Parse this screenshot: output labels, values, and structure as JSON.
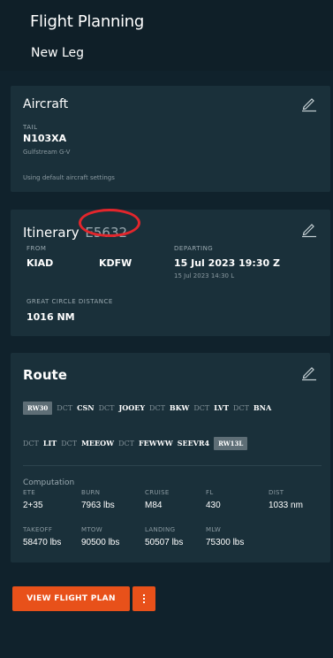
{
  "header": {
    "title": "Flight Planning",
    "subtitle": "New Leg"
  },
  "aircraft": {
    "title": "Aircraft",
    "tail_label": "TAIL",
    "tail": "N103XA",
    "model": "Gulfstream G-V",
    "settings_note": "Using default aircraft settings",
    "edit_icon": "pencil-icon"
  },
  "itinerary": {
    "title": "Itinerary",
    "annotation": "E5632",
    "from_label": "FROM",
    "from": "KIAD",
    "to": "KDFW",
    "departing_label": "DEPARTING",
    "departing": "15 Jul 2023 19:30 Z",
    "departing_local": "15 Jul 2023 14:30 L",
    "gc_label": "GREAT CIRCLE DISTANCE",
    "gc_distance": "1016 NM",
    "edit_icon": "pencil-icon"
  },
  "route": {
    "title": "Route",
    "line1": [
      {
        "t": "rw",
        "v": "RW30"
      },
      {
        "t": "kw",
        "v": "DCT"
      },
      {
        "t": "wp",
        "v": "CSN"
      },
      {
        "t": "kw",
        "v": "DCT"
      },
      {
        "t": "wp",
        "v": "JOOEY"
      },
      {
        "t": "kw",
        "v": "DCT"
      },
      {
        "t": "wp",
        "v": "BKW"
      },
      {
        "t": "kw",
        "v": "DCT"
      },
      {
        "t": "wp",
        "v": "LVT"
      },
      {
        "t": "kw",
        "v": "DCT"
      },
      {
        "t": "wp",
        "v": "BNA"
      }
    ],
    "line2": [
      {
        "t": "kw",
        "v": "DCT"
      },
      {
        "t": "wp",
        "v": "LIT"
      },
      {
        "t": "kw",
        "v": "DCT"
      },
      {
        "t": "wp",
        "v": "MEEOW"
      },
      {
        "t": "kw",
        "v": "DCT"
      },
      {
        "t": "wp",
        "v": "FEWWW"
      },
      {
        "t": "wp",
        "v": "SEEVR4"
      },
      {
        "t": "rw",
        "v": "RW13L"
      }
    ],
    "computation_title": "Computation",
    "ete_label": "ETE",
    "ete": "2+35",
    "burn_label": "BURN",
    "burn": "7963 lbs",
    "cruise_label": "CRUISE",
    "cruise": "M84",
    "fl_label": "FL",
    "fl": "430",
    "dist_label": "DIST",
    "dist": "1033 nm",
    "takeoff_label": "TAKEOFF",
    "takeoff": "58470 lbs",
    "mtow_label": "MTOW",
    "mtow": "90500 lbs",
    "landing_label": "LANDING",
    "landing": "50507 lbs",
    "mlw_label": "MLW",
    "mlw": "75300 lbs",
    "edit_icon": "pencil-icon"
  },
  "actions": {
    "view_flight_plan": "VIEW FLIGHT PLAN",
    "more_icon": "more-vertical-icon"
  },
  "colors": {
    "background": "#10222c",
    "card": "#1a303a",
    "accent": "#e8511a",
    "annotation": "#e3262c"
  }
}
